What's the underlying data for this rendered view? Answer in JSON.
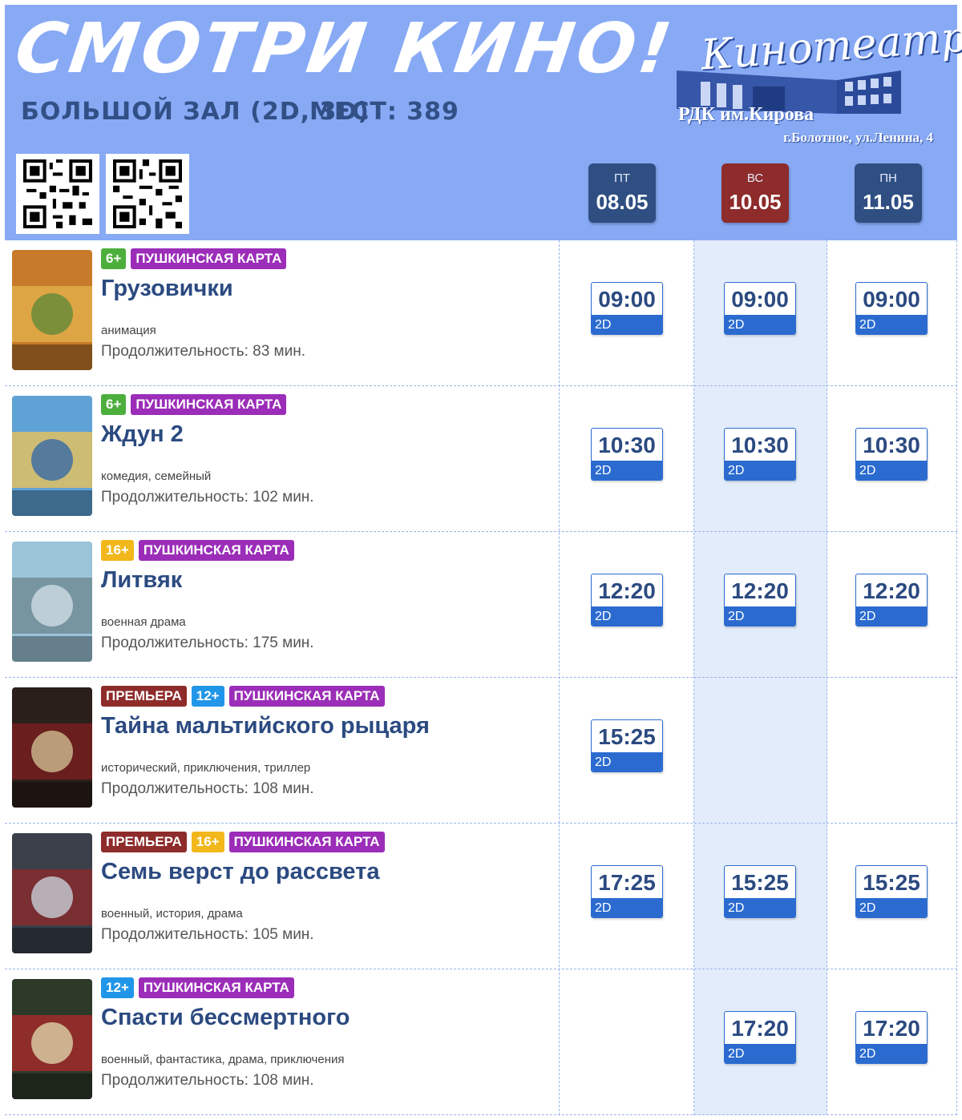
{
  "header": {
    "title": "СМОТРИ КИНО!",
    "hall": "БОЛЬШОЙ ЗАЛ (2D, 3D)",
    "seats": "МЕСТ: 389"
  },
  "logo": {
    "script": "Кинотеатр",
    "name": "РДК им.Кирова",
    "address": "г.Болотное, ул.Ленина, 4"
  },
  "days": [
    {
      "dow": "ПТ",
      "date": "08.05",
      "color": "#2f4f83"
    },
    {
      "dow": "ВС",
      "date": "10.05",
      "color": "#8e2b2b"
    },
    {
      "dow": "ПН",
      "date": "11.05",
      "color": "#2f4f83"
    }
  ],
  "movies": [
    {
      "badges": [
        "6+",
        "ПУШКИНСКАЯ КАРТА"
      ],
      "title": "Грузовички",
      "genre": "анимация",
      "duration": "Продолжительность: 83 мин.",
      "times": [
        "09:00",
        "09:00",
        "09:00"
      ],
      "format": "2D"
    },
    {
      "badges": [
        "6+",
        "ПУШКИНСКАЯ КАРТА"
      ],
      "title": "Ждун 2",
      "genre": "комедия, семейный",
      "duration": "Продолжительность: 102 мин.",
      "times": [
        "10:30",
        "10:30",
        "10:30"
      ],
      "format": "2D"
    },
    {
      "badges": [
        "16+",
        "ПУШКИНСКАЯ КАРТА"
      ],
      "title": "Литвяк",
      "genre": "военная драма",
      "duration": "Продолжительность: 175 мин.",
      "times": [
        "12:20",
        "12:20",
        "12:20"
      ],
      "format": "2D"
    },
    {
      "badges": [
        "ПРЕМЬЕРА",
        "12+",
        "ПУШКИНСКАЯ КАРТА"
      ],
      "title": "Тайна мальтийского рыцаря",
      "genre": "исторический, приключения, триллер",
      "duration": "Продолжительность: 108 мин.",
      "times": [
        "15:25",
        "",
        ""
      ],
      "format": "2D"
    },
    {
      "badges": [
        "ПРЕМЬЕРА",
        "16+",
        "ПУШКИНСКАЯ КАРТА"
      ],
      "title": "Семь верст до рассвета",
      "genre": "военный, история, драма",
      "duration": "Продолжительность: 105 мин.",
      "times": [
        "17:25",
        "15:25",
        "15:25"
      ],
      "format": "2D"
    },
    {
      "badges": [
        "12+",
        "ПУШКИНСКАЯ КАРТА"
      ],
      "title": "Спасти бессмертного",
      "genre": "военный, фантастика, драма, приключения",
      "duration": "Продолжительность: 108 мин.",
      "times": [
        "",
        "17:20",
        "17:20"
      ],
      "format": "2D"
    }
  ]
}
